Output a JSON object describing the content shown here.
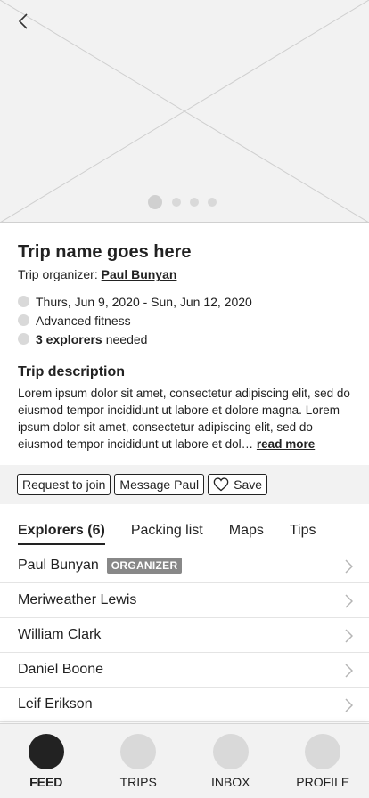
{
  "hero": {
    "icons": {
      "back": "chevron-left-icon"
    },
    "carousel": {
      "count": 4,
      "active_index": 0
    }
  },
  "trip": {
    "title": "Trip name goes here",
    "organizer_prefix": "Trip organizer:",
    "organizer_name": "Paul Bunyan",
    "facts": {
      "dates": "Thurs, Jun 9, 2020 - Sun, Jun 12, 2020",
      "fitness": "Advanced fitness",
      "explorers_count": "3 explorers",
      "explorers_suffix": "needed"
    },
    "description_title": "Trip description",
    "description": "Lorem ipsum dolor sit amet, consectetur adipiscing elit, sed do eiusmod tempor incididunt ut labore et dolore magna. Lorem ipsum dolor sit amet, consectetur adipiscing elit, sed do eiusmod tempor incididunt ut labore et dol…",
    "read_more": "read more"
  },
  "actions": {
    "request": "Request to join",
    "message": "Message Paul",
    "save": "Save",
    "save_icon": "heart-icon"
  },
  "tabs": [
    {
      "label": "Explorers (6)",
      "active": true
    },
    {
      "label": "Packing list",
      "active": false
    },
    {
      "label": "Maps",
      "active": false
    },
    {
      "label": "Tips",
      "active": false
    }
  ],
  "explorers": [
    {
      "name": "Paul Bunyan",
      "badge": "ORGANIZER"
    },
    {
      "name": "Meriweather Lewis"
    },
    {
      "name": "William Clark"
    },
    {
      "name": "Daniel Boone"
    },
    {
      "name": "Leif Erikson"
    }
  ],
  "bottom_nav": [
    {
      "label": "FEED",
      "active": true
    },
    {
      "label": "TRIPS",
      "active": false
    },
    {
      "label": "INBOX",
      "active": false
    },
    {
      "label": "PROFILE",
      "active": false
    }
  ],
  "colors": {
    "placeholder_bg": "#f2f2f2",
    "text": "#222222",
    "badge_bg": "#888888",
    "dot": "#d9d9d9",
    "active_nav": "#222222"
  }
}
